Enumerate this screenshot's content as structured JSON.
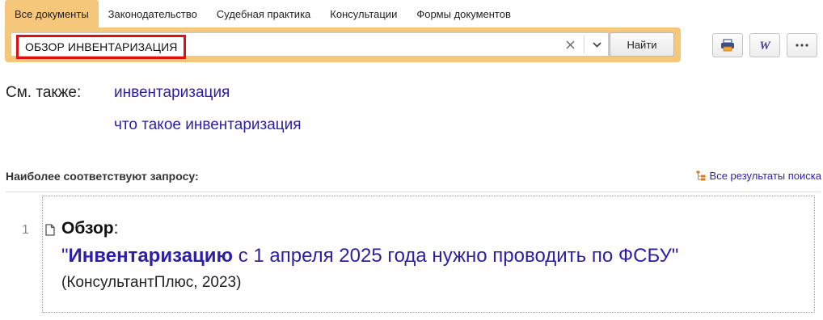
{
  "tabs": [
    {
      "label": "Все документы",
      "active": true
    },
    {
      "label": "Законодательство"
    },
    {
      "label": "Судебная практика"
    },
    {
      "label": "Консультации"
    },
    {
      "label": "Формы документов"
    }
  ],
  "search": {
    "value": "ОБЗОР ИНВЕНТАРИЗАЦИЯ",
    "find_label": "Найти",
    "clear_icon": "close-icon",
    "dropdown_icon": "chevron-down-icon"
  },
  "toolbar": {
    "print_icon": "print-icon",
    "word_icon": "word-export-icon",
    "more_icon": "more-icon"
  },
  "see_also": {
    "label": "См. также:",
    "links": [
      "инвентаризация",
      "что такое инвентаризация"
    ]
  },
  "results": {
    "heading": "Наиболее соответствуют запросу:",
    "all_results_label": "Все результаты поиска",
    "items": [
      {
        "number": "1",
        "type": "Обзор",
        "type_suffix": ":",
        "quote_open": "\"",
        "title_highlight": "Инвентаризацию",
        "title_rest": " с 1 апреля 2025 года нужно проводить по ФСБУ",
        "quote_close": "\"",
        "source": "(КонсультантПлюс, 2023)"
      }
    ]
  },
  "colors": {
    "accent": "#f5c77a",
    "link": "#2b1fa8",
    "highlight_border": "#e01010",
    "icon_orange": "#e07a1f"
  }
}
